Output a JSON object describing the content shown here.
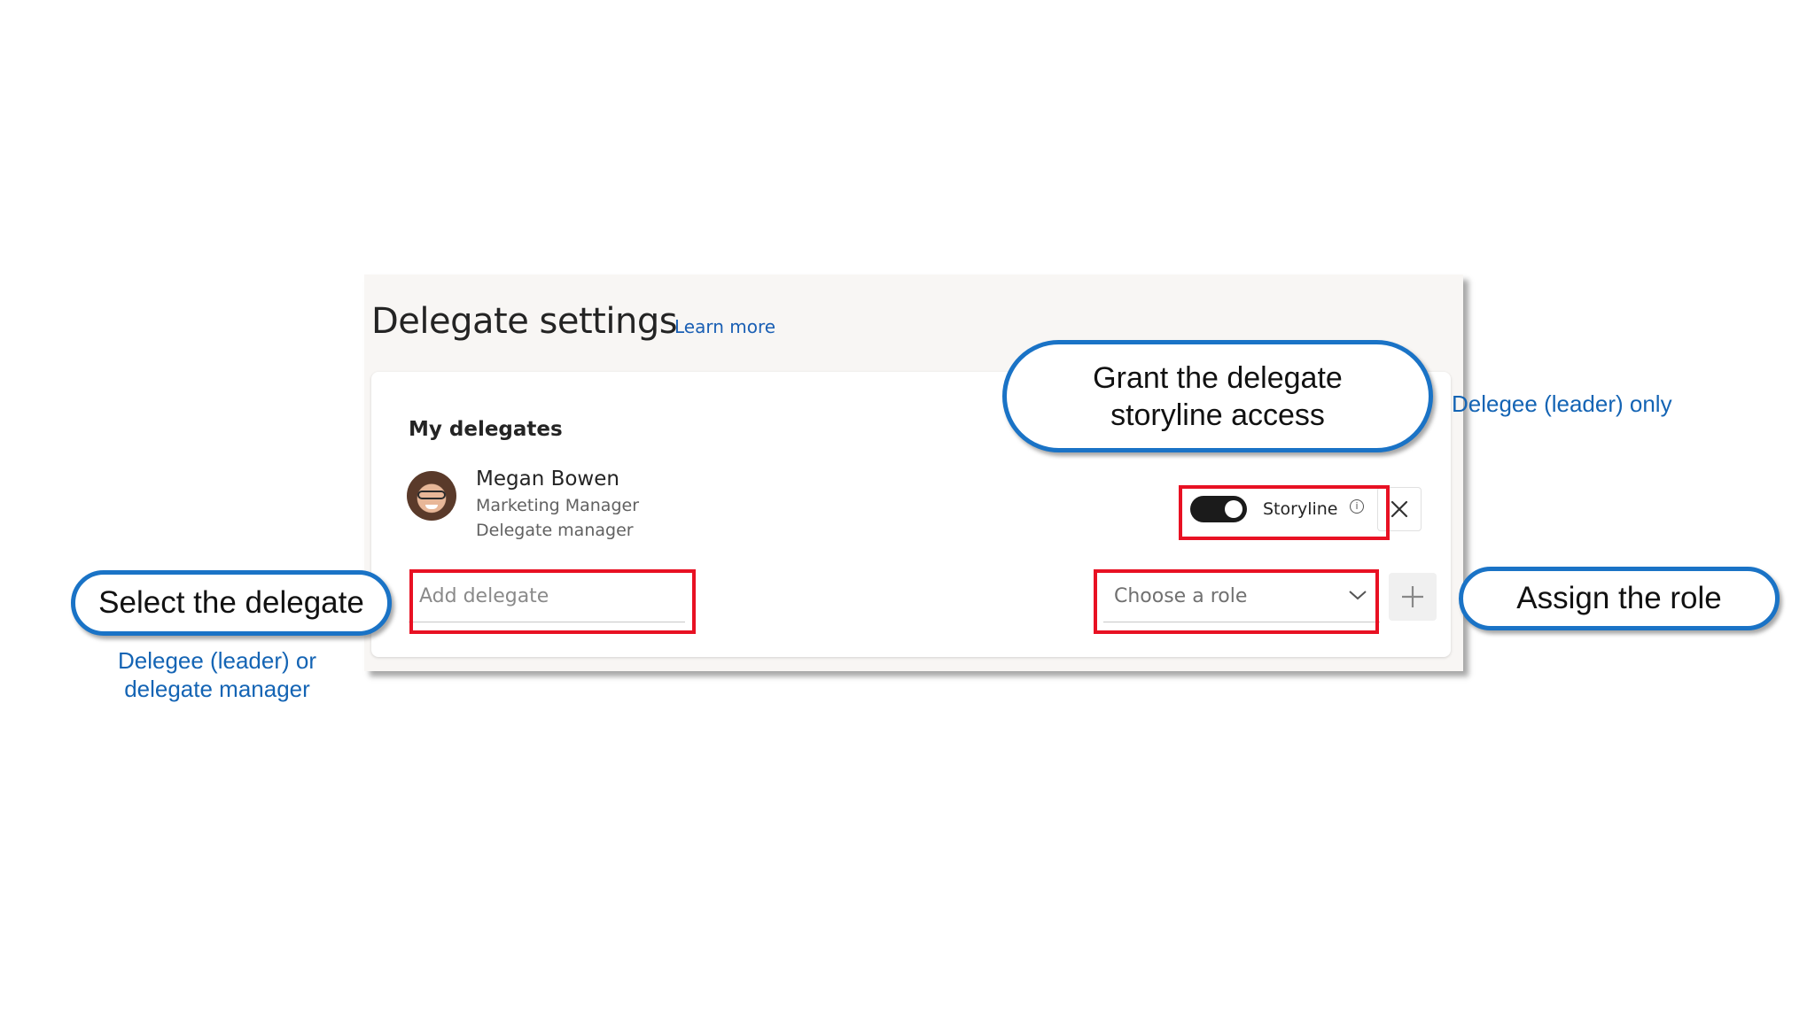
{
  "panel": {
    "title": "Delegate settings",
    "learn_more": "Learn more",
    "section_title": "My delegates"
  },
  "delegate": {
    "name": "Megan Bowen",
    "job_title": "Marketing Manager",
    "role": "Delegate manager",
    "storyline_label": "Storyline",
    "storyline_enabled": true
  },
  "add_row": {
    "delegate_placeholder": "Add delegate",
    "role_placeholder": "Choose a role"
  },
  "callouts": {
    "storyline": "Grant the delegate storyline access",
    "select": "Select the delegate",
    "assign": "Assign the role"
  },
  "notes": {
    "leader_only": "Delegee (leader) only",
    "leader_or_manager_line1": "Delegee (leader) or",
    "leader_or_manager_line2": "delegate manager"
  },
  "colors": {
    "highlight": "#e81123",
    "callout_border": "#1a73c6",
    "note_text": "#1464b4"
  }
}
